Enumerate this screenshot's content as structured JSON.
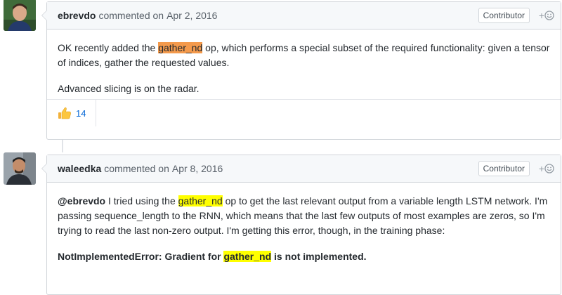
{
  "comments": [
    {
      "author": "ebrevdo",
      "action": "commented on",
      "date": "Apr 2, 2016",
      "badge": "Contributor",
      "add_reaction": "+",
      "p1_before": "OK recently added the ",
      "p1_highlight": "gather_nd",
      "p1_after": " op, which performs a special subset of the required functionality: given a tensor of indices, gather the requested values.",
      "p2": "Advanced slicing is on the radar.",
      "reaction_icon": "thumbs-up-icon",
      "reaction_count": "14",
      "highlight_color": "#f49a4c"
    },
    {
      "author": "waleedka",
      "action": "commented on",
      "date": "Apr 8, 2016",
      "badge": "Contributor",
      "add_reaction": "+",
      "mention": "@ebrevdo",
      "p1_a": " I tried using the ",
      "p1_highlight": "gather_nd",
      "p1_b": " op to get the last relevant output from a variable length LSTM network. I'm passing sequence_length to the RNN, which means that the last few outputs of most examples are zeros, so I'm trying to read the last non-zero output. I'm getting this error, though, in the training phase:",
      "p2_before": "NotImplementedError: Gradient for ",
      "p2_highlight": "gather_nd",
      "p2_after": " is not implemented.",
      "highlight_color": "#ffff00"
    }
  ],
  "colors": {
    "border": "#d1d5da",
    "header_bg": "#f6f8fa",
    "link": "#0366d6"
  }
}
